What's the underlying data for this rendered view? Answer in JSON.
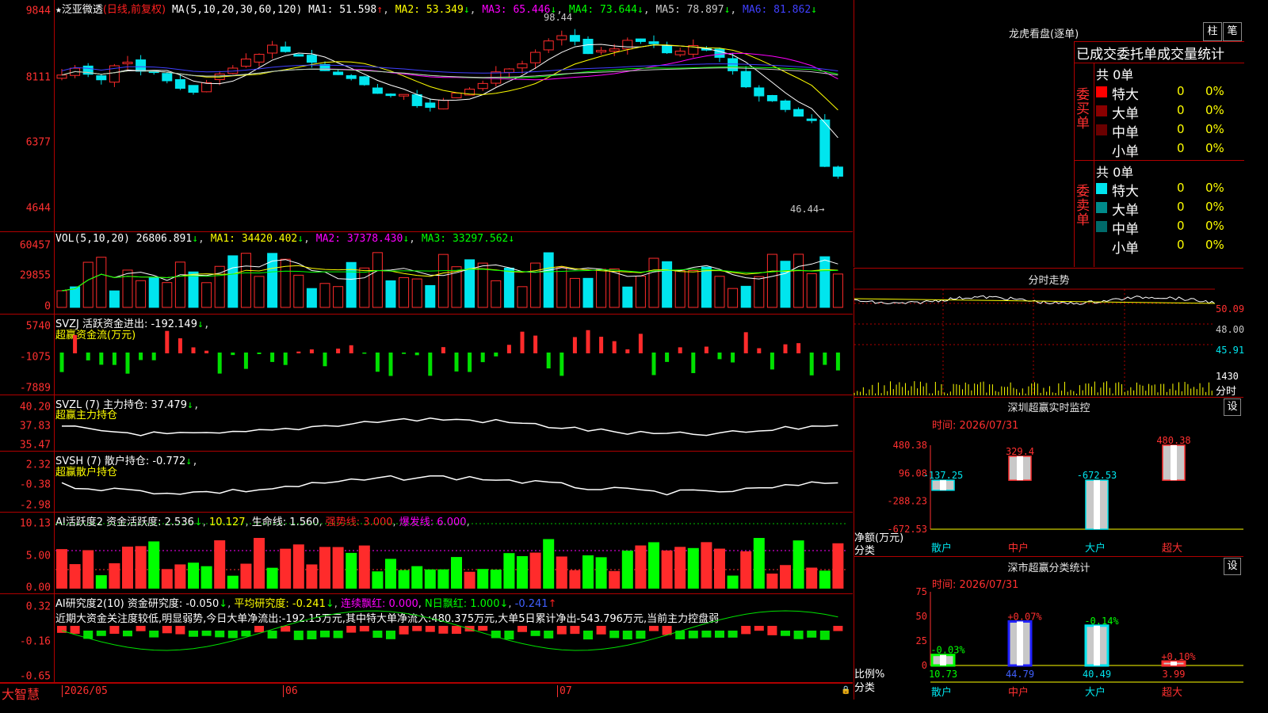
{
  "stock": {
    "name": "泛亚微透",
    "period": "(日线,前复权)"
  },
  "colors": {
    "up": "#ff2b2b",
    "down": "#00e5ee",
    "ma1": "#ffffff",
    "ma2": "#ffff00",
    "ma3": "#ff00ff",
    "ma4": "#00ff00",
    "ma5": "#c8c8c8",
    "ma6": "#4040ff"
  },
  "price_panel": {
    "ma_label": "MA(5,10,20,30,60,120)",
    "ma": [
      {
        "label": "MA1: 51.598",
        "arrow": "↑"
      },
      {
        "label": "MA2: 53.349",
        "arrow": "↓"
      },
      {
        "label": "MA3: 65.446",
        "arrow": "↓"
      },
      {
        "label": "MA4: 73.644",
        "arrow": "↓"
      },
      {
        "label": "MA5: 78.897",
        "arrow": "↓"
      },
      {
        "label": "MA6: 81.862",
        "arrow": "↓"
      }
    ],
    "axis": [
      "9844",
      "8111",
      "6377",
      "4644"
    ],
    "high_label": "98.44",
    "low_label": "46.44"
  },
  "vol_panel": {
    "label": "VOL(5,10,20)",
    "v0": "26806.891",
    "v1": "MA1: 34420.402",
    "v2": "MA2: 37378.430",
    "v3": "MA3: 33297.562",
    "axis": [
      "60457",
      "29855",
      "0"
    ]
  },
  "svzj_panel": {
    "label": "SVZJ  活跃资金进出: -192.149",
    "sub": "超赢资金流(万元)",
    "axis": [
      "5740",
      "-1075",
      "-7889"
    ]
  },
  "svzl_panel": {
    "label": "SVZL (7) 主力持仓: 37.479",
    "sub": "超赢主力持仓",
    "axis": [
      "40.20",
      "37.83",
      "35.47"
    ]
  },
  "svsh_panel": {
    "label": "SVSH (7) 散户持仓: -0.772",
    "sub": "超赢散户持仓",
    "axis": [
      "2.32",
      "-0.38",
      "-2.98"
    ]
  },
  "ai1_panel": {
    "label": "AI活跃度2 资金活跃度: 2.536",
    "v1": "10.127",
    "v2": "生命线: 1.560",
    "v3": "强势线: 3.000",
    "v4": "爆发线: 6.000",
    "axis": [
      "10.13",
      "5.00",
      "0.00"
    ]
  },
  "ai2_panel": {
    "label": "AI研究度2(10) 资金研究度: -0.050",
    "v1": "平均研究度: -0.241",
    "v2": "连续飘红: 0.000",
    "v3": "N日飘红: 1.000",
    "v4": "-0.241",
    "text": "近期大资金关注度较低,明显弱势,今日大单净流出:-192.15万元,其中特大单净流入:480.375万元,大单5日累计净出-543.796万元,当前主力控盘弱",
    "axis": [
      "0.32",
      "-0.16",
      "-0.65"
    ]
  },
  "bottom": {
    "brand": "大智慧",
    "dates": [
      "2026/05",
      "06",
      "07"
    ]
  },
  "lhb": {
    "title": "龙虎看盘(逐单)",
    "btn1": "柱",
    "btn2": "笔",
    "header": "已成交委托单成交量统计",
    "buy_label": "委买单",
    "sell_label": "委卖单",
    "buy_total": "共 0单",
    "sell_total": "共 0单",
    "buy": [
      {
        "name": "特大",
        "count": "0",
        "pct": "0%",
        "color": "#ff0000"
      },
      {
        "name": "大单",
        "count": "0",
        "pct": "0%",
        "color": "#8b0000"
      },
      {
        "name": "中单",
        "count": "0",
        "pct": "0%",
        "color": "#6a0000"
      },
      {
        "name": "小单",
        "count": "0",
        "pct": "0%",
        "color": "#000000"
      }
    ],
    "sell": [
      {
        "name": "特大",
        "count": "0",
        "pct": "0%",
        "color": "#00e5ee"
      },
      {
        "name": "大单",
        "count": "0",
        "pct": "0%",
        "color": "#008b8b"
      },
      {
        "name": "中单",
        "count": "0",
        "pct": "0%",
        "color": "#006a6a"
      },
      {
        "name": "小单",
        "count": "0",
        "pct": "0%",
        "color": "#000000"
      }
    ]
  },
  "fenshi": {
    "title": "分时走势",
    "axis": [
      "50.09",
      "48.00",
      "45.91",
      "1430"
    ],
    "unit": "分时"
  },
  "monitor": {
    "title": "深圳超赢实时监控",
    "btn": "设",
    "time": "时间: 2026/07/31",
    "axis": [
      "480.38",
      "96.08",
      "-288.23",
      "-672.53"
    ],
    "ylabel": "净额(万元)",
    "xlabel": "分类",
    "cats": [
      "散户",
      "中户",
      "大户",
      "超大"
    ],
    "values": [
      -137.25,
      329.4,
      -672.53,
      480.38
    ],
    "labels": [
      "-137.25",
      "329.4",
      "-672.53",
      "480.38"
    ]
  },
  "classify": {
    "title": "深市超赢分类统计",
    "btn": "设",
    "time": "时间: 2026/07/31",
    "axis": [
      "75",
      "50",
      "25",
      "0"
    ],
    "ylabel": "比例%",
    "xlabel": "分类",
    "cats": [
      "散户",
      "中户",
      "大户",
      "超大"
    ],
    "values": [
      10.73,
      44.79,
      40.49,
      3.99
    ],
    "labels": [
      "10.73",
      "44.79",
      "40.49",
      "3.99"
    ],
    "changes": [
      "-0.03%",
      "+0.07%",
      "-0.14%",
      "+0.10%"
    ]
  }
}
